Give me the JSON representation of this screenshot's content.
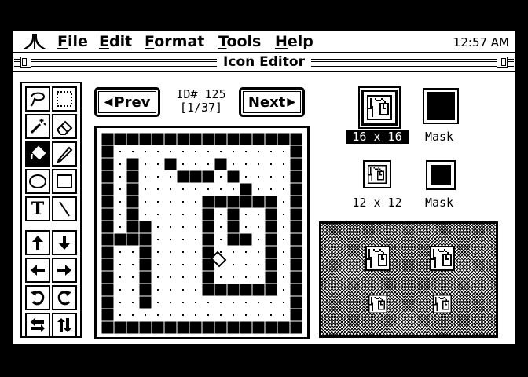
{
  "menubar": {
    "items": [
      {
        "label": "File",
        "underline": "F"
      },
      {
        "label": "Edit",
        "underline": "E"
      },
      {
        "label": "Format",
        "underline": "F"
      },
      {
        "label": "Tools",
        "underline": "T"
      },
      {
        "label": "Help",
        "underline": "H"
      }
    ],
    "clock": "12:57 AM"
  },
  "window": {
    "title": "Icon Editor"
  },
  "tools": [
    "lasso-icon",
    "marquee-icon",
    "magic-wand-icon",
    "eraser-icon",
    "paint-bucket-icon",
    "pencil-icon",
    "oval-icon",
    "rectangle-icon",
    "text-tool-icon",
    "line-icon",
    "shift-up-icon",
    "shift-down-icon",
    "shift-left-icon",
    "shift-right-icon",
    "rotate-ccw-icon",
    "rotate-cw-icon",
    "flip-horizontal-icon",
    "flip-vertical-icon"
  ],
  "tool_glyphs": {
    "text": "T"
  },
  "selected_tool": "paint-bucket-icon",
  "navigation": {
    "prev_label": "Prev",
    "next_label": "Next",
    "id_text": "ID# 125",
    "index_text": "[1/37]"
  },
  "sizes": [
    {
      "label": "16 x 16",
      "mask_label": "Mask",
      "selected": true
    },
    {
      "label": "12 x 12",
      "mask_label": "Mask",
      "selected": false
    }
  ],
  "icon_bitmap": [
    "################",
    "#..............#",
    "#.#..#...#.....#",
    "#.#...###.#....#",
    "#.#........#...#",
    "#.#.....######.#",
    "#.#.....#.#..#.#",
    "#.##....#.#..#.#",
    "####....#.##.#.#",
    "#..#....#....#.#",
    "#..#....#....#.#",
    "#..#....#....#.#",
    "#..#....######.#",
    "#..#...........#",
    "#..............#",
    "################"
  ],
  "colors": {
    "background": "#000000",
    "screen": "#ffffff",
    "ink": "#000000"
  }
}
